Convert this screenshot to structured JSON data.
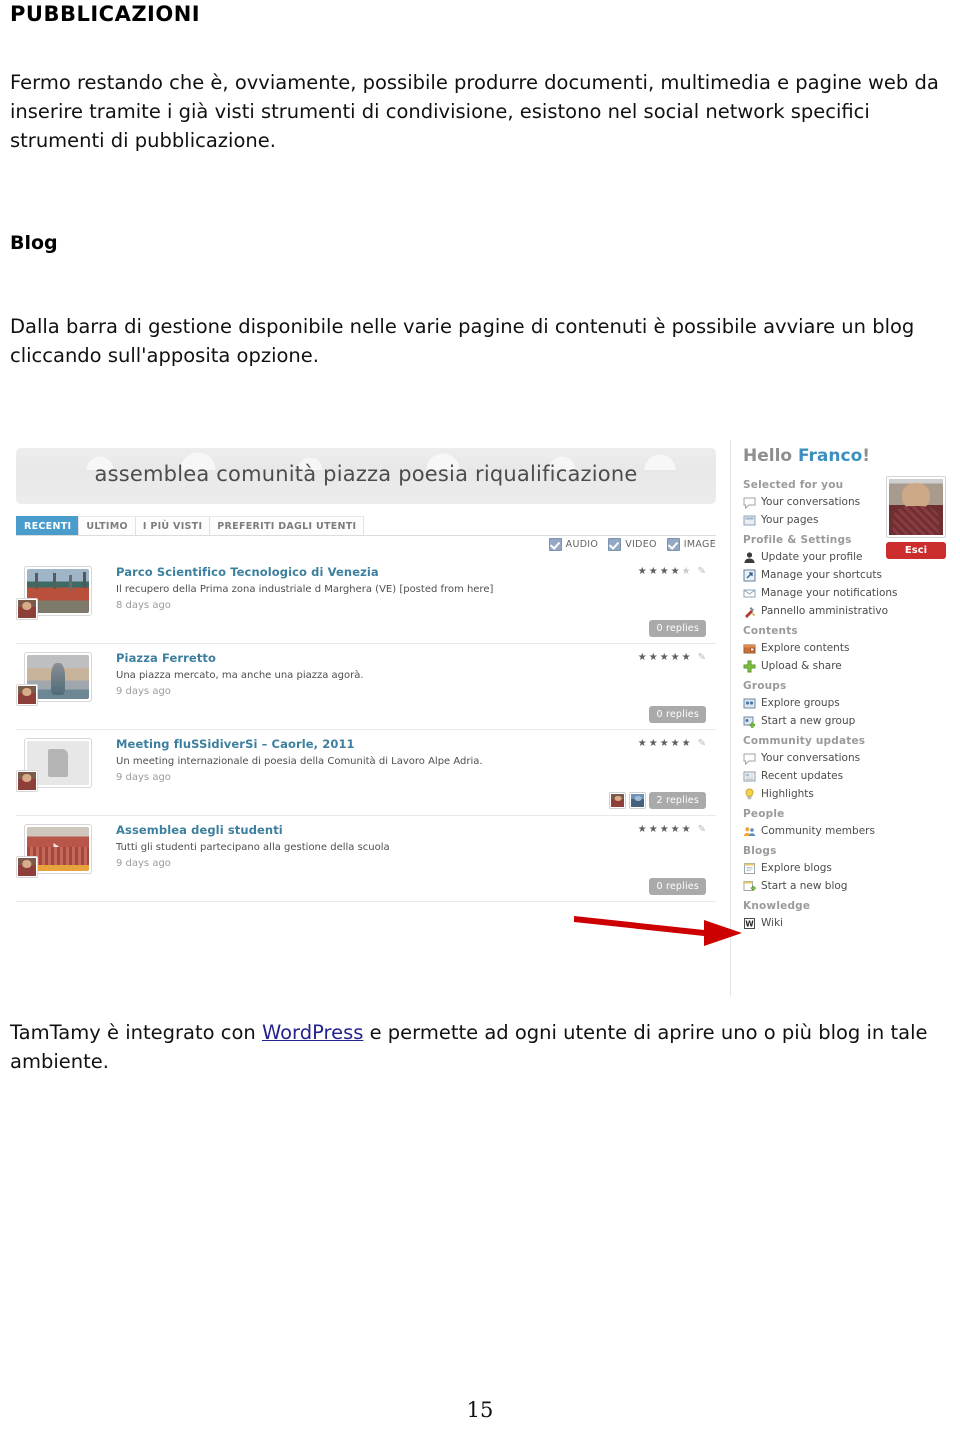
{
  "document": {
    "title": "PUBBLICAZIONI",
    "intro_paragraph": "Fermo restando che è, ovviamente, possibile produrre documenti, multimedia e pagine web da inserire tramite i già visti strumenti di condivisione, esistono nel social network specifici strumenti di pubblicazione.",
    "blog_heading": "Blog",
    "blog_paragraph": "Dalla barra di gestione disponibile nelle varie pagine di contenuti è possibile avviare un blog cliccando sull'apposita opzione.",
    "bottom_paragraph_before": "TamTamy è integrato con ",
    "bottom_link": "WordPress",
    "bottom_paragraph_after": " e permette ad ogni utente di aprire uno o più blog in tale ambiente.",
    "page_number": "15"
  },
  "screenshot": {
    "banner_title": "assemblea comunità piazza poesia riqualificazione",
    "tabs": [
      {
        "label": "RECENTI",
        "active": true
      },
      {
        "label": "ULTIMO",
        "active": false
      },
      {
        "label": "I PIÙ VISTI",
        "active": false
      },
      {
        "label": "PREFERITI DAGLI UTENTI",
        "active": false
      }
    ],
    "media_filters": [
      {
        "label": "AUDIO",
        "checked": true
      },
      {
        "label": "VIDEO",
        "checked": true
      },
      {
        "label": "IMAGE",
        "checked": true
      }
    ],
    "feed": [
      {
        "title": "Parco Scientifico Tecnologico di Venezia",
        "description": "Il recupero della Prima zona industriale d Marghera (VE) [posted from here]",
        "time": "8 days ago",
        "rating": 4,
        "max_rating": 5,
        "replies_label": "0 replies",
        "reply_avatars": 0
      },
      {
        "title": "Piazza Ferretto",
        "description": "Una piazza mercato, ma anche una piazza agorà.",
        "time": "9 days ago",
        "rating": 5,
        "max_rating": 5,
        "replies_label": "0 replies",
        "reply_avatars": 0
      },
      {
        "title": "Meeting fluSSidiverSi – Caorle, 2011",
        "description": "Un meeting internazionale di poesia della Comunità di Lavoro Alpe Adria.",
        "time": "9 days ago",
        "rating": 5,
        "max_rating": 5,
        "replies_label": "2 replies",
        "reply_avatars": 2
      },
      {
        "title": "Assemblea degli studenti",
        "description": "Tutti gli studenti partecipano alla gestione della scuola",
        "time": "9 days ago",
        "rating": 5,
        "max_rating": 5,
        "replies_label": "0 replies",
        "reply_avatars": 0
      }
    ],
    "sidebar": {
      "greeting_hello": "Hello ",
      "greeting_name": "Franco",
      "greeting_excl": "!",
      "logout_label": "Esci",
      "groups": [
        {
          "title": "Selected for you",
          "items": [
            {
              "label": "Your conversations",
              "icon": "speech-bubble-icon"
            },
            {
              "label": "Your pages",
              "icon": "page-icon"
            }
          ]
        },
        {
          "title": "Profile & Settings",
          "items": [
            {
              "label": "Update your profile",
              "icon": "person-icon"
            },
            {
              "label": "Manage your shortcuts",
              "icon": "shortcut-arrow-icon"
            },
            {
              "label": "Manage your notifications",
              "icon": "envelope-icon"
            },
            {
              "label": "Pannello amministrativo",
              "icon": "tools-icon"
            }
          ]
        },
        {
          "title": "Contents",
          "items": [
            {
              "label": "Explore contents",
              "icon": "box-icon"
            },
            {
              "label": "Upload & share",
              "icon": "green-plus-icon"
            }
          ]
        },
        {
          "title": "Groups",
          "items": [
            {
              "label": "Explore groups",
              "icon": "group-icon"
            },
            {
              "label": "Start a new group",
              "icon": "group-add-icon"
            }
          ]
        },
        {
          "title": "Community updates",
          "items": [
            {
              "label": "Your conversations",
              "icon": "speech-bubble-icon"
            },
            {
              "label": "Recent updates",
              "icon": "news-icon"
            },
            {
              "label": "Highlights",
              "icon": "lightbulb-icon"
            }
          ]
        },
        {
          "title": "People",
          "items": [
            {
              "label": "Community members",
              "icon": "people-icon"
            }
          ]
        },
        {
          "title": "Blogs",
          "items": [
            {
              "label": "Explore blogs",
              "icon": "notebook-icon"
            },
            {
              "label": "Start a new blog",
              "icon": "notebook-add-icon"
            }
          ]
        },
        {
          "title": "Knowledge",
          "items": [
            {
              "label": "Wiki",
              "icon": "wiki-w-icon"
            }
          ]
        }
      ]
    },
    "annotation": {
      "arrow_color": "#cc0000",
      "points_to": "Start a new blog"
    }
  },
  "colors": {
    "tab_active": "#4a9ccd",
    "link": "#23238e",
    "item_title": "#3d7f9e",
    "logout_red": "#cc2d2d",
    "arrow_red": "#cc0000"
  }
}
